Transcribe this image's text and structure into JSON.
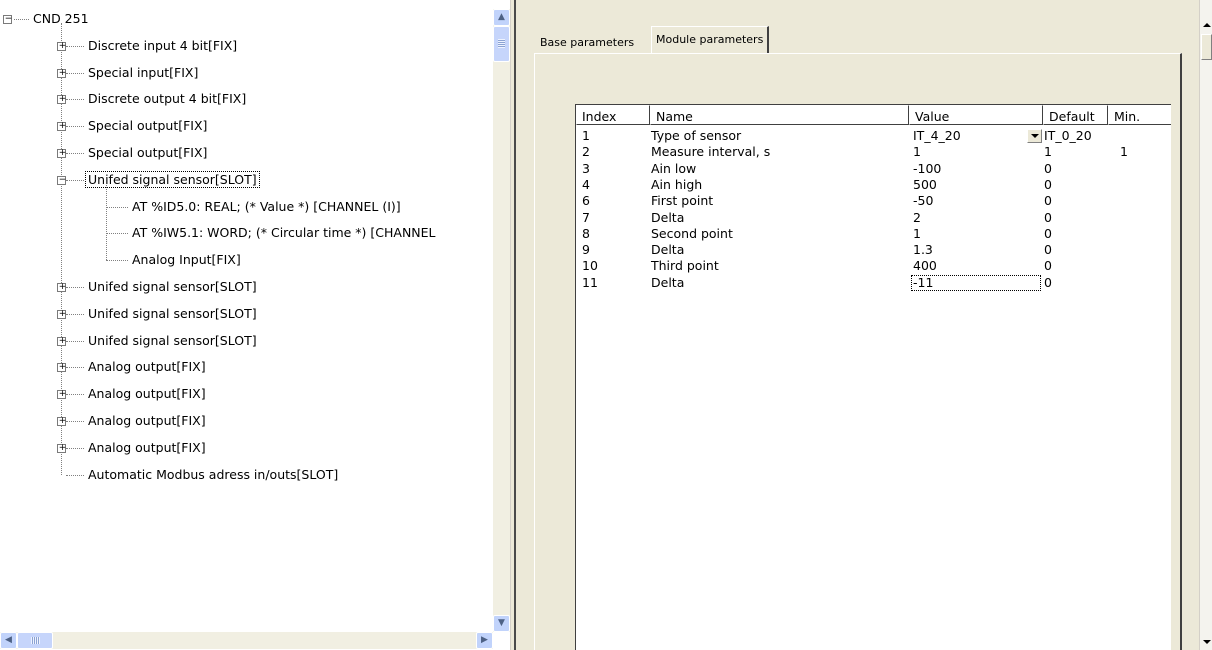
{
  "tree": {
    "nodes": [
      {
        "label": "CND 251",
        "expander": "minus"
      },
      {
        "label": "Discrete input 4 bit[FIX]",
        "expander": "plus"
      },
      {
        "label": "Special input[FIX]",
        "expander": "plus"
      },
      {
        "label": "Discrete output 4 bit[FIX]",
        "expander": "plus"
      },
      {
        "label": "Special output[FIX]",
        "expander": "plus"
      },
      {
        "label": "Special output[FIX]",
        "expander": "plus"
      },
      {
        "label": "Unifed signal sensor[SLOT]",
        "expander": "minus",
        "selected": true
      },
      {
        "label": "AT %ID5.0: REAL; (* Value *) [CHANNEL (I)]",
        "expander": "none"
      },
      {
        "label": "AT %IW5.1: WORD; (* Circular time *) [CHANNEL",
        "expander": "none"
      },
      {
        "label": "Analog Input[FIX]",
        "expander": "none"
      },
      {
        "label": "Unifed signal sensor[SLOT]",
        "expander": "plus"
      },
      {
        "label": "Unifed signal sensor[SLOT]",
        "expander": "plus"
      },
      {
        "label": "Unifed signal sensor[SLOT]",
        "expander": "plus"
      },
      {
        "label": "Analog output[FIX]",
        "expander": "plus"
      },
      {
        "label": "Analog output[FIX]",
        "expander": "plus"
      },
      {
        "label": "Analog output[FIX]",
        "expander": "plus"
      },
      {
        "label": "Analog output[FIX]",
        "expander": "plus"
      },
      {
        "label": "Automatic Modbus adress in/outs[SLOT]",
        "expander": "none"
      }
    ],
    "scroll_up_glyph": "▲",
    "scroll_down_glyph": "▼",
    "scroll_left_glyph": "◀",
    "scroll_right_glyph": "▶"
  },
  "tabs": {
    "base_label": "Base parameters",
    "module_label": "Module parameters"
  },
  "grid": {
    "columns": [
      "Index",
      "Name",
      "Value",
      "Default",
      "Min."
    ],
    "rows": [
      {
        "index": "1",
        "name": "Type of sensor",
        "value": "IT_4_20",
        "default": "IT_0_20",
        "min": ""
      },
      {
        "index": "2",
        "name": "Measure interval, s",
        "value": "1",
        "default": "1",
        "min": "1"
      },
      {
        "index": "3",
        "name": "Ain low",
        "value": "-100",
        "default": "0",
        "min": ""
      },
      {
        "index": "4",
        "name": "Ain high",
        "value": "500",
        "default": "0",
        "min": ""
      },
      {
        "index": "6",
        "name": "First point",
        "value": "-50",
        "default": "0",
        "min": ""
      },
      {
        "index": "7",
        "name": "Delta",
        "value": "2",
        "default": "0",
        "min": ""
      },
      {
        "index": "8",
        "name": "Second point",
        "value": "1",
        "default": "0",
        "min": ""
      },
      {
        "index": "9",
        "name": "Delta",
        "value": "1.3",
        "default": "0",
        "min": ""
      },
      {
        "index": "10",
        "name": "Third point",
        "value": "400",
        "default": "0",
        "min": ""
      },
      {
        "index": "11",
        "name": "Delta",
        "value": "-11",
        "default": "0",
        "min": ""
      }
    ]
  },
  "colors": {
    "panel": "#ece9d8",
    "scroll_button": "#c1d3fb",
    "splitter_line": "#4a4a4a"
  }
}
